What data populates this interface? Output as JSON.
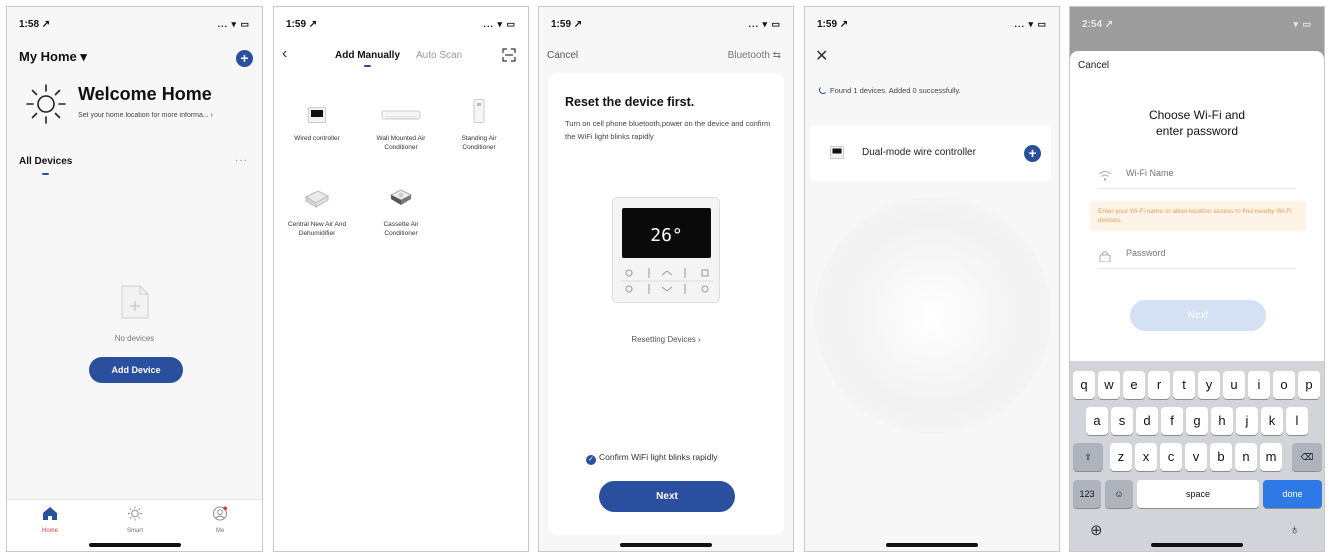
{
  "phones": [
    {
      "status": {
        "time": "1:58 ↗",
        "icons": "... ▾ ▭"
      },
      "header": {
        "title": "My Home ▾",
        "add_icon": "plus-circle-icon"
      },
      "welcome": {
        "title": "Welcome Home",
        "subtitle": "Set your home location for more informa...  ›",
        "icon": "sun-icon"
      },
      "section": {
        "title": "All Devices",
        "more": "···"
      },
      "empty": {
        "text": "No devices",
        "icon": "empty-document-icon"
      },
      "add_button": "Add Device",
      "tabs": [
        {
          "label": "Home",
          "icon": "home-icon",
          "active": true
        },
        {
          "label": "Smart",
          "icon": "sun-icon",
          "active": false
        },
        {
          "label": "Me",
          "icon": "user-icon",
          "active": false
        }
      ],
      "colors": {
        "accent": "#2a4f9e",
        "badge": "#e53935"
      }
    },
    {
      "status": {
        "time": "1:59 ↗",
        "icons": "... ▾ ▭"
      },
      "tabs": [
        "Add Manually",
        "Auto Scan"
      ],
      "back_icon": "chevron-left-icon",
      "scan_icon": "scan-icon",
      "devices": [
        {
          "label": "Wired controller",
          "icon": "wired-controller-icon"
        },
        {
          "label": "Wall Mounted Air Conditioner",
          "icon": "wall-ac-icon"
        },
        {
          "label": "Standing Air Conditioner",
          "icon": "standing-ac-icon"
        },
        {
          "label": "Central New Air And Dehumidifier",
          "icon": "dehumidifier-icon"
        },
        {
          "label": "Cassette Air Conditioner",
          "icon": "cassette-ac-icon"
        }
      ]
    },
    {
      "status": {
        "time": "1:59 ↗",
        "icons": "... ▾ ▭"
      },
      "cancel": "Cancel",
      "bluetooth": "Bluetooth ⇆",
      "title": "Reset the device first.",
      "description": "Turn on cell phone bluetooth,power on the device and confirm the WiFi light blinks rapidly",
      "device_temp": "26°",
      "reset_link": "Resetting Devices ›",
      "confirm": "Confirm WiFi light blinks rapidly",
      "confirm_checked": true,
      "next": "Next"
    },
    {
      "status": {
        "time": "1:59 ↗",
        "icons": "... ▾ ▭"
      },
      "close_icon": "close-icon",
      "found": "Found 1 devices. Added 0 successfully.",
      "device": {
        "name": "Dual-mode wire controller",
        "icon": "wired-controller-icon",
        "add_icon": "plus-circle-icon"
      }
    },
    {
      "status": {
        "time": "2:54 ↗",
        "icons": "▾ ▭"
      },
      "cancel": "Cancel",
      "title_line1": "Choose Wi-Fi and",
      "title_line2": "enter password",
      "wifi_placeholder": "Wi-Fi Name",
      "warning": "Enter your Wi-Fi name or allow location access to find nearby Wi-Fi devices.",
      "password_placeholder": "Password",
      "next": "Next",
      "keyboard": {
        "row1": [
          "q",
          "w",
          "e",
          "r",
          "t",
          "y",
          "u",
          "i",
          "o",
          "p"
        ],
        "row2": [
          "a",
          "s",
          "d",
          "f",
          "g",
          "h",
          "j",
          "k",
          "l"
        ],
        "row3": [
          "z",
          "x",
          "c",
          "v",
          "b",
          "n",
          "m"
        ],
        "shift_icon": "shift-icon",
        "delete_icon": "delete-icon",
        "numbers": "123",
        "emoji_icon": "emoji-icon",
        "space": "space",
        "done": "done",
        "globe_icon": "globe-icon",
        "mic_icon": "microphone-icon"
      }
    }
  ]
}
